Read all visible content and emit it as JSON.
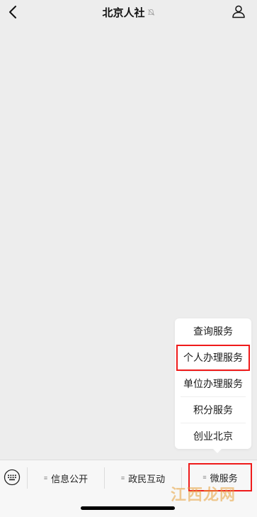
{
  "header": {
    "title": "北京人社",
    "back_icon": "chevron-left-icon",
    "mute_icon": "bell-muted-icon",
    "profile_icon": "person-icon"
  },
  "popup_menu": {
    "items": [
      {
        "label": "查询服务"
      },
      {
        "label": "个人办理服务",
        "highlighted": true
      },
      {
        "label": "单位办理服务"
      },
      {
        "label": "积分服务"
      },
      {
        "label": "创业北京"
      }
    ]
  },
  "menu_bar": {
    "keyboard_icon": "keyboard-icon",
    "items": [
      {
        "label": "信息公开"
      },
      {
        "label": "政民互动"
      },
      {
        "label": "微服务",
        "highlighted": true
      }
    ]
  },
  "watermark": {
    "text": "江西龙网"
  },
  "colors": {
    "background": "#ededed",
    "highlight_border": "#ef1a1a",
    "watermark": "#e8a13a"
  }
}
